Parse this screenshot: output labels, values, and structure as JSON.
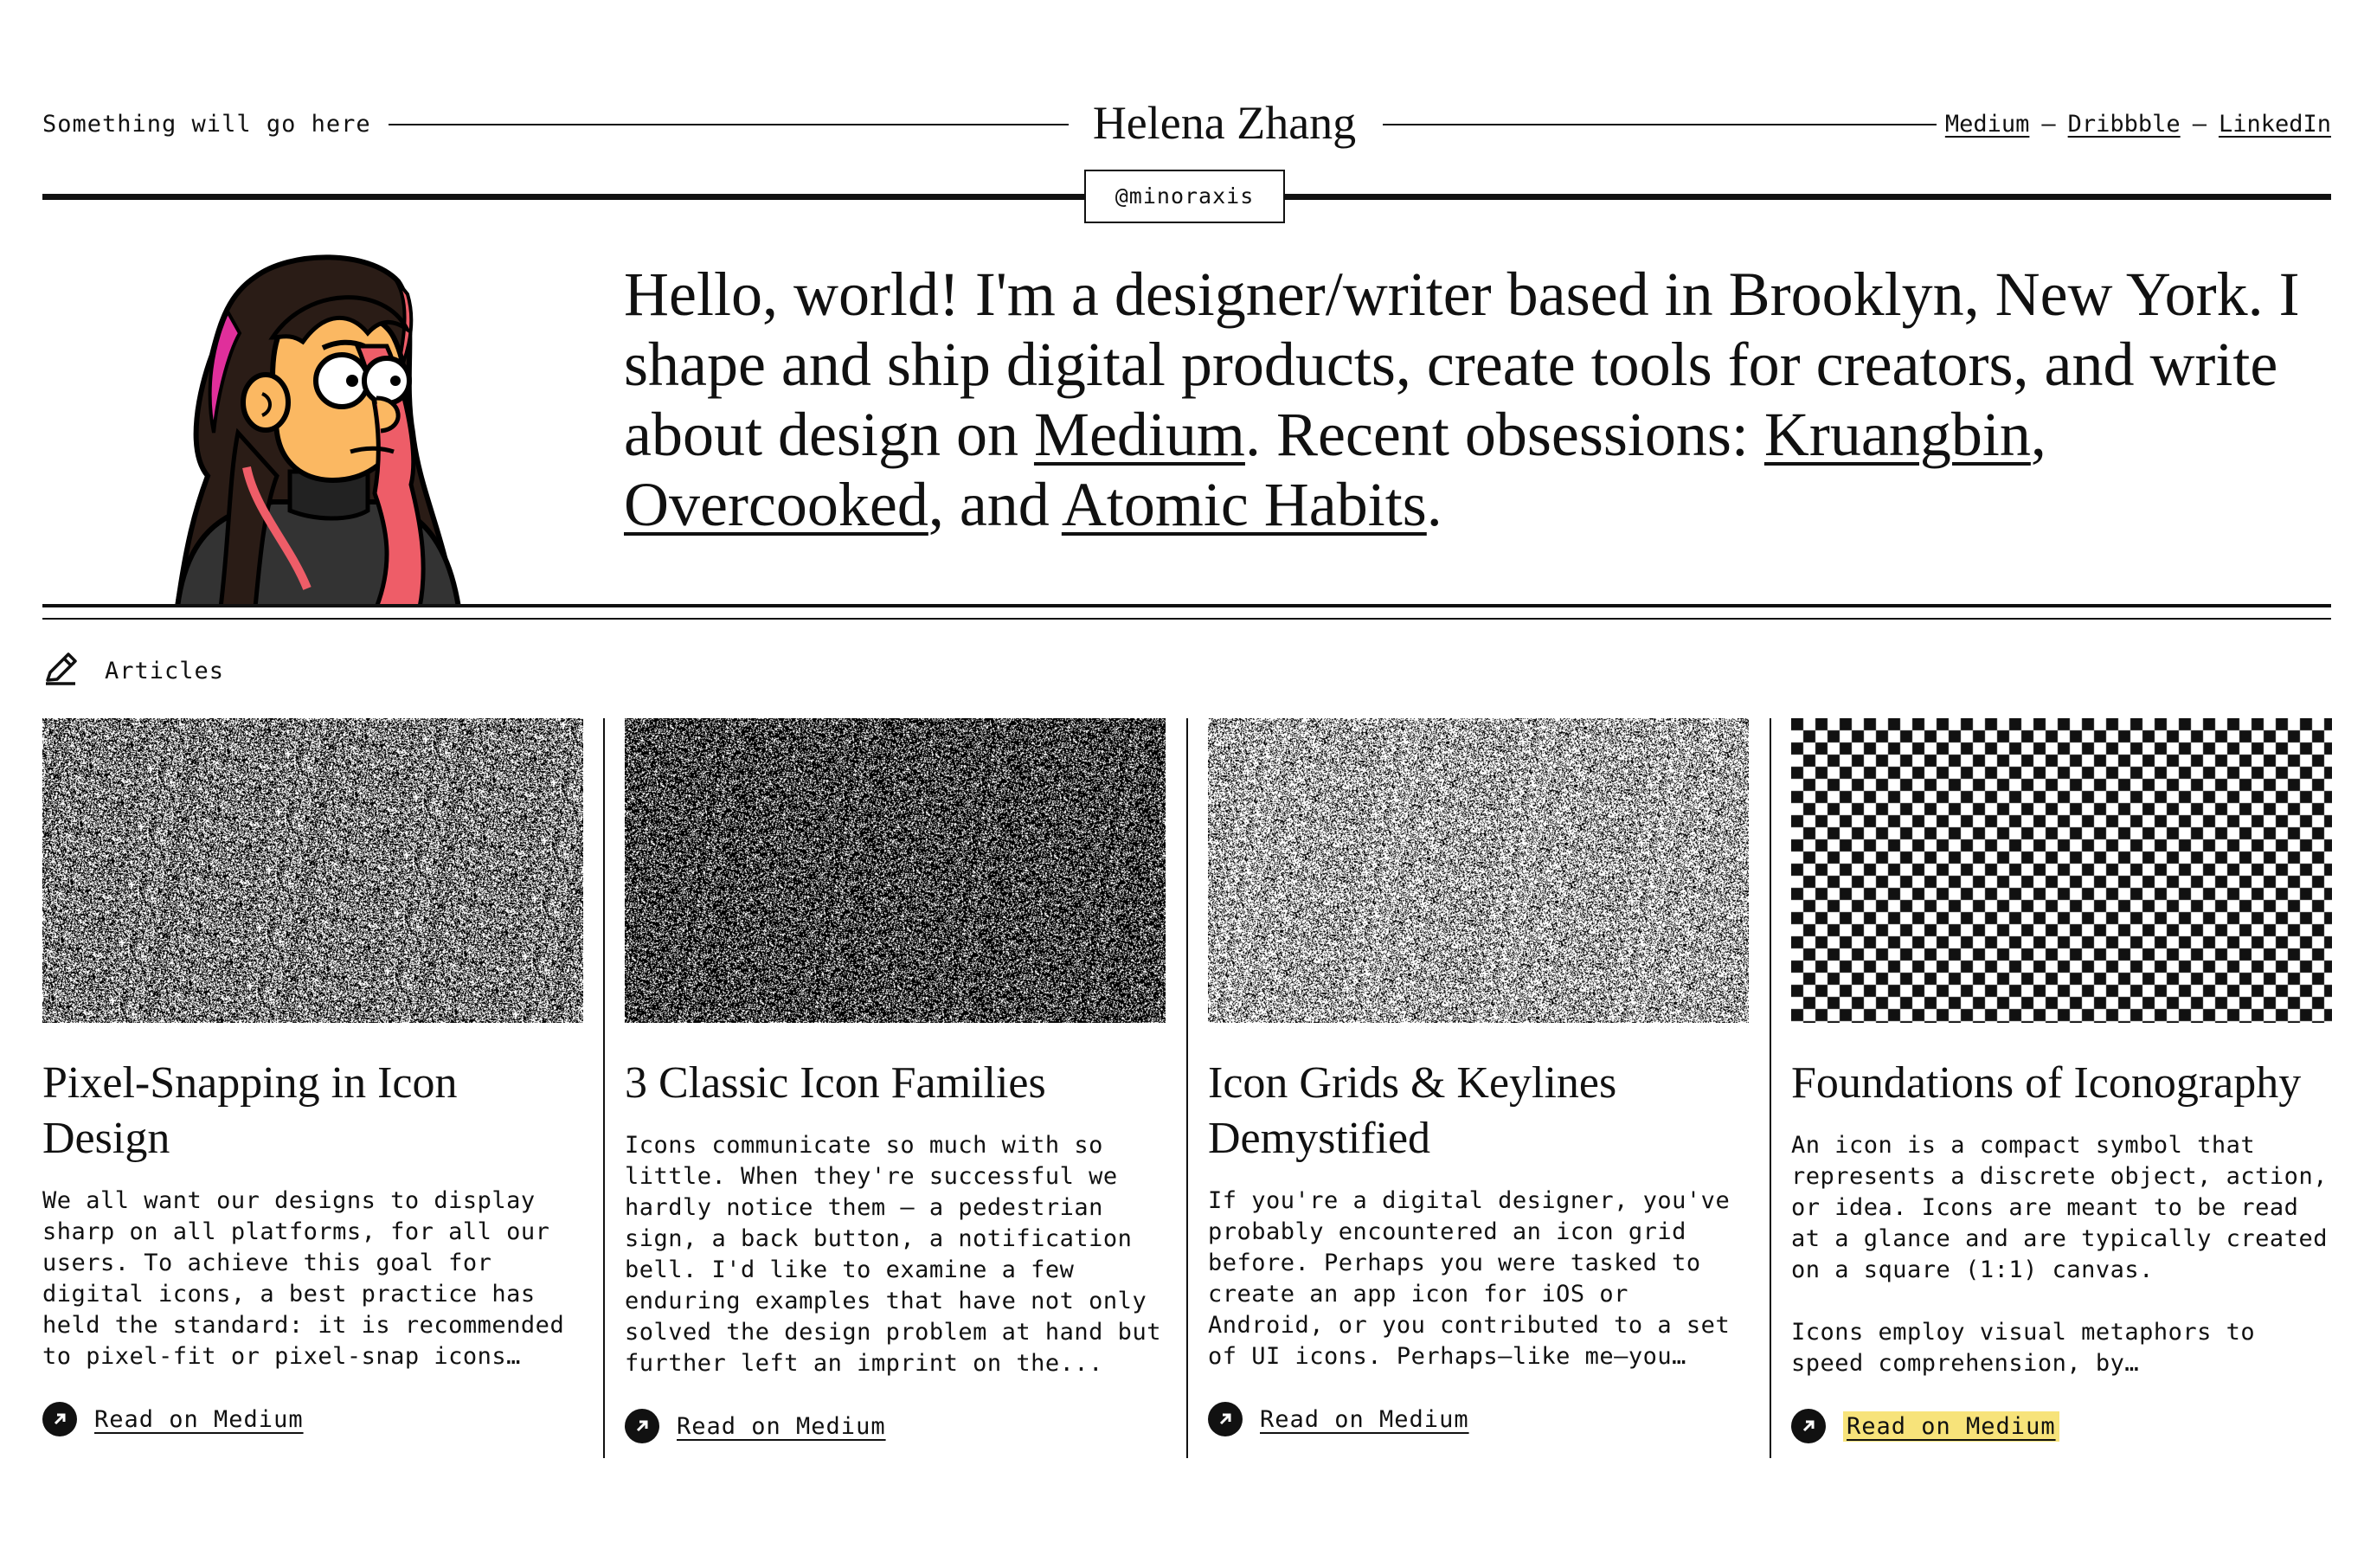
{
  "header": {
    "tagline": "Something will go here",
    "title": "Helena Zhang",
    "handle": "@minoraxis",
    "social": [
      {
        "label": "Medium"
      },
      {
        "label": "Dribbble"
      },
      {
        "label": "LinkedIn"
      }
    ],
    "separator": "–"
  },
  "hero": {
    "bio": {
      "intro": "Hello, world! I'm a designer/writer based in Brooklyn, New York. I shape and ship digital products, create tools for creators, and write about design on ",
      "link_medium": "Medium",
      "mid": ". Recent obsessions: ",
      "link_1": "Kruangbin",
      "comma": ", ",
      "link_2": "Overcooked",
      "and": ", and ",
      "link_3": "Atomic Habits",
      "end": "."
    }
  },
  "articles": {
    "section_label": "Articles",
    "items": [
      {
        "title": "Pixel-Snapping in Icon Design",
        "excerpt": "We all want our designs to display sharp on all platforms, for all our users. To achieve this goal for digital icons, a best practice has held the standard: it is recommended to pixel-fit or pixel-snap icons…",
        "link": "Read on Medium",
        "image": "noise-medium"
      },
      {
        "title": "3 Classic Icon Families",
        "excerpt": "Icons communicate so much with so little. When they're successful we hardly notice them — a pedestrian sign, a back button, a notification bell. I'd like to examine a few enduring examples that have not only solved the design problem at hand but further left an imprint on the...",
        "link": "Read on Medium",
        "image": "noise-dark"
      },
      {
        "title": "Icon Grids & Keylines Demystified",
        "excerpt": "If you're a digital designer, you've probably encountered an icon grid before. Perhaps you were tasked to create an app icon for iOS or Android, or you contributed to a set of UI icons. Perhaps—like me—you…",
        "link": "Read on Medium",
        "image": "noise-light"
      },
      {
        "title": "Foundations of Iconography",
        "excerpt": "An icon is a compact symbol that represents a discrete object, action, or idea. Icons are meant to be read at a glance and are typically created on a square (1:1) canvas.\n\nIcons employ visual metaphors to speed comprehension, by…",
        "link": "Read on Medium",
        "image": "checkerboard",
        "link_highlight": "#f7e37a"
      }
    ]
  },
  "colors": {
    "ink": "#111111",
    "background": "#ffffff",
    "highlight": "#f7e37a"
  }
}
